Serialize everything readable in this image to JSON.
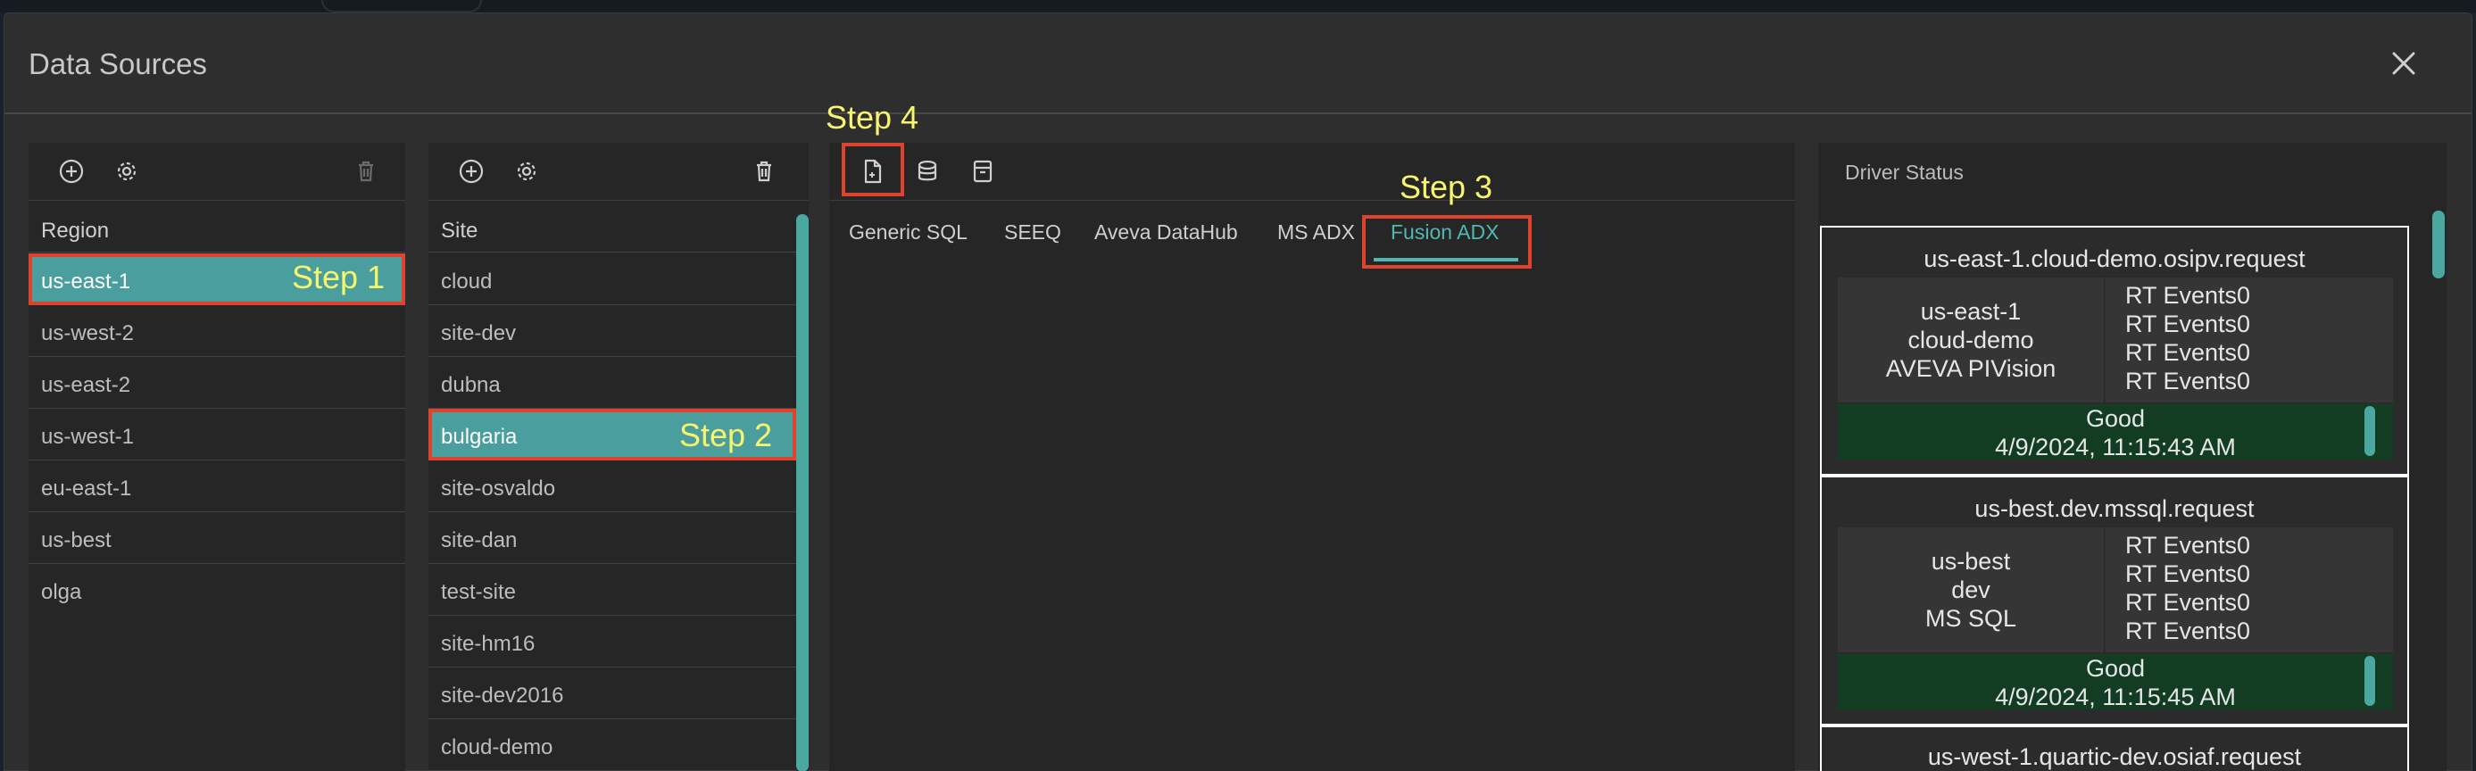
{
  "dialog": {
    "title": "Data Sources"
  },
  "region_list": {
    "header": "Region",
    "items": [
      "us-east-1",
      "us-west-2",
      "us-east-2",
      "us-west-1",
      "eu-east-1",
      "us-best",
      "olga"
    ],
    "selected": "us-east-1"
  },
  "site_list": {
    "header": "Site",
    "items": [
      "cloud",
      "site-dev",
      "dubna",
      "bulgaria",
      "site-osvaldo",
      "site-dan",
      "test-site",
      "site-hm16",
      "site-dev2016",
      "cloud-demo"
    ],
    "selected": "bulgaria"
  },
  "tabs": [
    "Generic SQL",
    "SEEQ",
    "Aveva DataHub",
    "MS ADX",
    "Fusion ADX"
  ],
  "active_tab": "Fusion ADX",
  "annotations": {
    "step1": "Step 1",
    "step2": "Step 2",
    "step3": "Step 3",
    "step4": "Step 4"
  },
  "driver_status": {
    "title": "Driver Status",
    "cards": [
      {
        "title": "us-east-1.cloud-demo.osipv.request",
        "region": "us-east-1",
        "site": "cloud-demo",
        "driver": "AVEVA PIVision",
        "events": [
          "RT Events0",
          "RT Events0",
          "RT Events0",
          "RT Events0"
        ],
        "status": "Good",
        "timestamp": "4/9/2024, 11:15:43 AM"
      },
      {
        "title": "us-best.dev.mssql.request",
        "region": "us-best",
        "site": "dev",
        "driver": "MS SQL",
        "events": [
          "RT Events0",
          "RT Events0",
          "RT Events0",
          "RT Events0"
        ],
        "status": "Good",
        "timestamp": "4/9/2024, 11:15:45 AM"
      },
      {
        "title": "us-west-1.quartic-dev.osiaf.request"
      }
    ]
  },
  "colors": {
    "accent": "#4a9e9e",
    "annotation_box": "#e0432b",
    "annotation_text": "#f7f56e",
    "status_good_bg": "#133d22"
  },
  "icons": {
    "region_toolbar": [
      "add-circle-icon",
      "gear-icon",
      "trash-icon"
    ],
    "site_toolbar": [
      "add-circle-icon",
      "gear-icon",
      "trash-icon"
    ],
    "main_toolbar": [
      "new-file-icon",
      "database-icon",
      "archive-icon"
    ],
    "close": "close-icon"
  }
}
